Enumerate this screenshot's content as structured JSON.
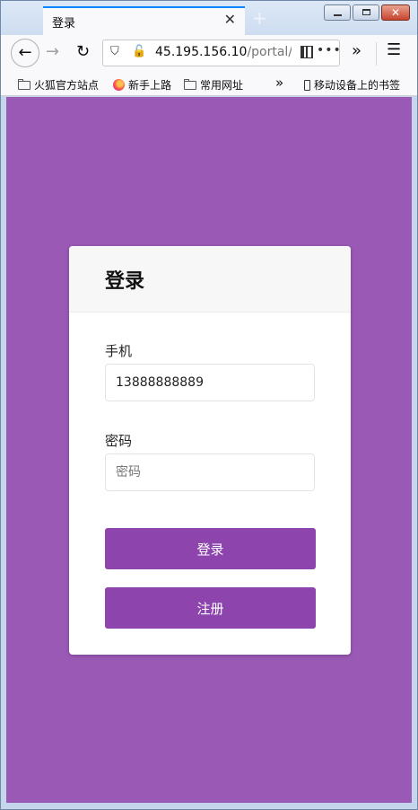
{
  "browser": {
    "tab": {
      "title": "登录",
      "close_glyph": "✕"
    },
    "new_tab_glyph": "+",
    "window_controls": {
      "close_glyph": "✕"
    },
    "nav": {
      "back_glyph": "←",
      "forward_glyph": "→",
      "reload_glyph": "↻",
      "overflow_glyph": "»",
      "menu_glyph": "☰"
    },
    "url": {
      "host": "45.195.156.10",
      "path": "/portal/u",
      "more_glyph": "•••",
      "shield_glyph": "⛉",
      "insecure_glyph": "🔓"
    },
    "bookmarks": [
      {
        "label": "火狐官方站点",
        "icon": "folder-icon"
      },
      {
        "label": "新手上路",
        "icon": "firefox-icon"
      },
      {
        "label": "常用网址",
        "icon": "folder-icon"
      }
    ],
    "bookmarks_overflow_glyph": "»",
    "mobile_bookmarks": {
      "label": "移动设备上的书签",
      "icon": "phone-icon"
    }
  },
  "page": {
    "background_color": "#9b59b6",
    "button_color": "#8e44ad",
    "card": {
      "title": "登录",
      "phone": {
        "label": "手机",
        "value": "13888888889"
      },
      "password": {
        "label": "密码",
        "placeholder": "密码",
        "value": ""
      },
      "login_button": "登录",
      "register_button": "注册"
    }
  }
}
